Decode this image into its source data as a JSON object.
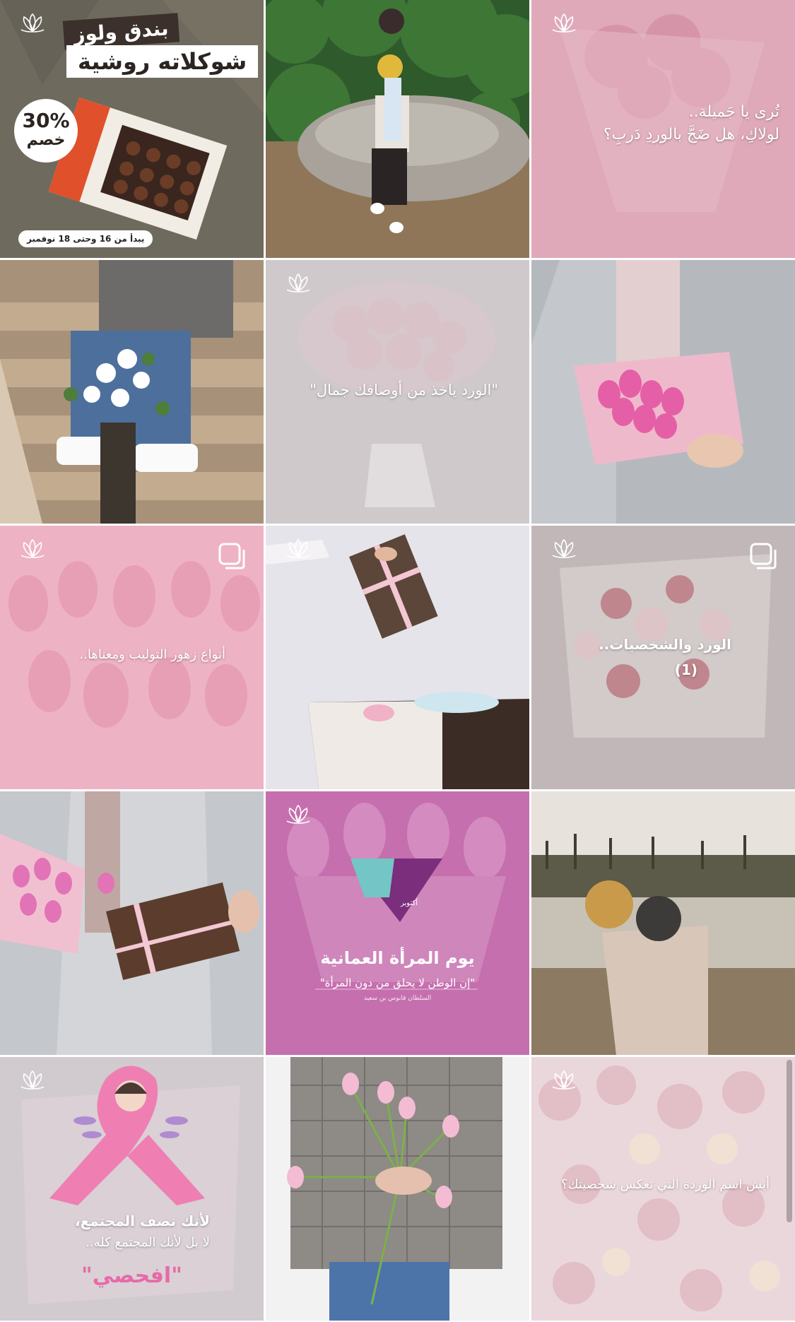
{
  "posts": [
    {
      "id": "chocolate-promo",
      "title_line1": "بندق ولوز",
      "title_line2": "شوكلاته روشية",
      "discount_percent": "30%",
      "discount_word": "خصم",
      "date_range": "يبدأ من 16 وحتى 18 نوفمبر"
    },
    {
      "id": "woman-sunflowers"
    },
    {
      "id": "rose-quote",
      "caption_line1": "تُرى يا جَميلة..",
      "caption_line2": "لولاكِ، هل ضَجَّ بالوردِ دَربِ؟"
    },
    {
      "id": "vase-bouquet"
    },
    {
      "id": "roses-quote",
      "caption": "\"الورد ياخذ من أوصافك جمال\""
    },
    {
      "id": "pink-tulips-held"
    },
    {
      "id": "tulip-types",
      "caption": "أنواع زهور التوليب ومعناها.."
    },
    {
      "id": "gift-box-table"
    },
    {
      "id": "roses-personalities",
      "caption_line1": "الورد والشخصيات..",
      "caption_line2": "(1)"
    },
    {
      "id": "tulips-chocolate-box"
    },
    {
      "id": "omani-women-day",
      "month_label": "أكتوبر",
      "title": "يوم المرأة العمانية",
      "quote": "\"إن الوطن لا يحلق من دون المرأة\"",
      "author": "السلطان قابوس بن سعيد"
    },
    {
      "id": "woman-lake"
    },
    {
      "id": "breast-cancer",
      "line1": "لأنك نصف المجتمع،",
      "line2": "لا بل لأنك المجتمع كله..",
      "line3": "\"افحصي\""
    },
    {
      "id": "tulips-behind-back"
    },
    {
      "id": "rose-name-question",
      "caption": "أيش اسم الوردة التي تعكس شخصيتك؟"
    }
  ],
  "colors": {
    "mauve": "#c56fae",
    "pink_overlay": "#e9b3c7",
    "ribbon": "#ef7fb3"
  }
}
